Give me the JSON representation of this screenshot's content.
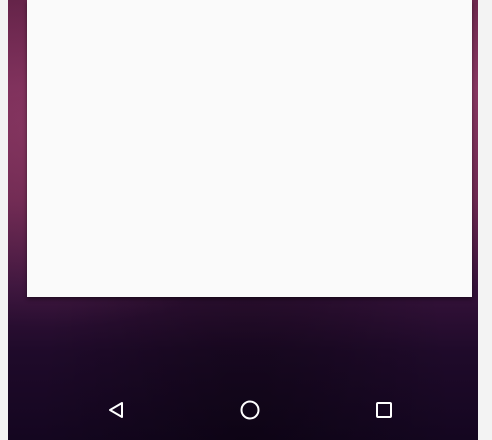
{
  "wallpaper": {
    "top_color": "#6b2450",
    "bottom_color": "#140620"
  },
  "card": {
    "background": "#fafafa"
  },
  "navigation_bar": {
    "buttons": [
      {
        "name": "back",
        "icon": "back-triangle-icon"
      },
      {
        "name": "home",
        "icon": "home-circle-icon"
      },
      {
        "name": "recents",
        "icon": "recents-square-icon"
      }
    ],
    "icon_color": "#ffffff"
  }
}
